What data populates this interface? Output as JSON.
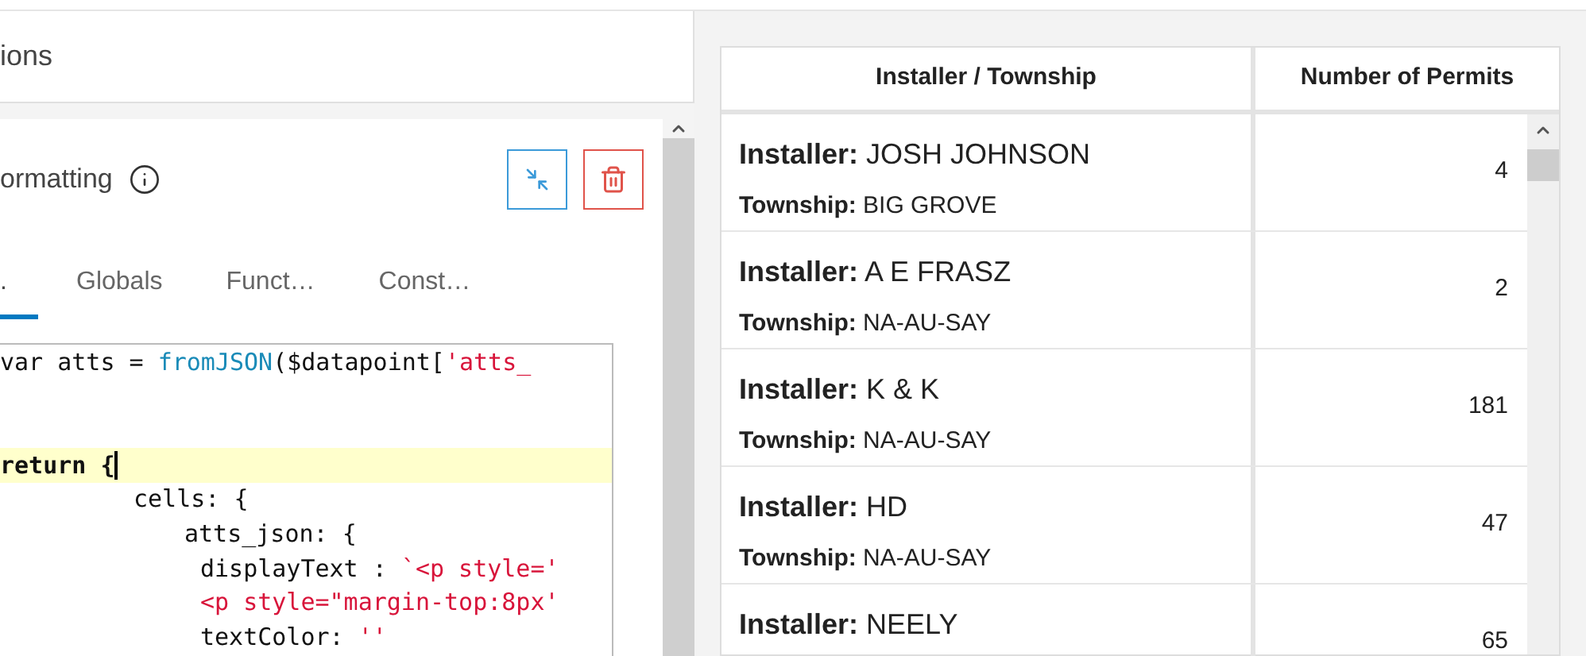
{
  "left_panel": {
    "header_title": "ions",
    "section_title": "ormatting",
    "tabs": [
      {
        "label": ".",
        "selected": true
      },
      {
        "label": "Globals",
        "selected": false
      },
      {
        "label": "Funct…",
        "selected": false
      },
      {
        "label": "Const…",
        "selected": false
      }
    ],
    "code_lines": [
      {
        "kind": "code",
        "highlighted": false,
        "tokens": [
          {
            "kind": "plain",
            "text": "var atts = "
          },
          {
            "kind": "func",
            "text": "fromJSON"
          },
          {
            "kind": "plain",
            "text": "($datapoint["
          },
          {
            "kind": "string",
            "text": "'atts_"
          }
        ]
      },
      {
        "kind": "blank",
        "highlighted": false
      },
      {
        "kind": "blank",
        "highlighted": false
      },
      {
        "kind": "code",
        "highlighted": true,
        "tokens": [
          {
            "kind": "keyword",
            "text": "return {"
          }
        ],
        "children": [
          {
            "kind": "code",
            "highlighted": false,
            "tokens": [
              {
                "kind": "plain",
                "text": "cells: {"
              }
            ],
            "children": [
              {
                "kind": "code",
                "highlighted": false,
                "tokens": [
                  {
                    "kind": "plain",
                    "text": "atts_json: {"
                  }
                ],
                "children": [
                  {
                    "kind": "code",
                    "highlighted": false,
                    "tokens": [
                      {
                        "kind": "plain",
                        "text": "displayText : "
                      },
                      {
                        "kind": "string",
                        "text": "`<p style='"
                      }
                    ]
                  },
                  {
                    "kind": "code",
                    "highlighted": false,
                    "tokens": [
                      {
                        "kind": "string",
                        "text": "<p style=\"margin-top:8px'"
                      }
                    ]
                  },
                  {
                    "kind": "code",
                    "highlighted": false,
                    "tokens": [
                      {
                        "kind": "plain",
                        "text": "textColor: "
                      },
                      {
                        "kind": "string",
                        "text": "''"
                      }
                    ]
                  }
                ]
              }
            ]
          }
        ]
      }
    ]
  },
  "table": {
    "columns": [
      "Installer / Township",
      "Number of Permits"
    ],
    "rows": [
      {
        "installer": "**Installer:** JOSH JOHNSON",
        "township": "**Township:** BIG GROVE",
        "permits": "4"
      },
      {
        "installer": "**Installer:** A E FRASZ",
        "township": "**Township:** NA-AU-SAY",
        "permits": "2"
      },
      {
        "installer": "**Installer:** K & K",
        "township": "**Township:** NA-AU-SAY",
        "permits": "181"
      },
      {
        "installer": "**Installer:** HD",
        "township": "**Township:** NA-AU-SAY",
        "permits": "47"
      },
      {
        "installer": "**Installer:** NEELY",
        "permits": "65"
      }
    ]
  }
}
